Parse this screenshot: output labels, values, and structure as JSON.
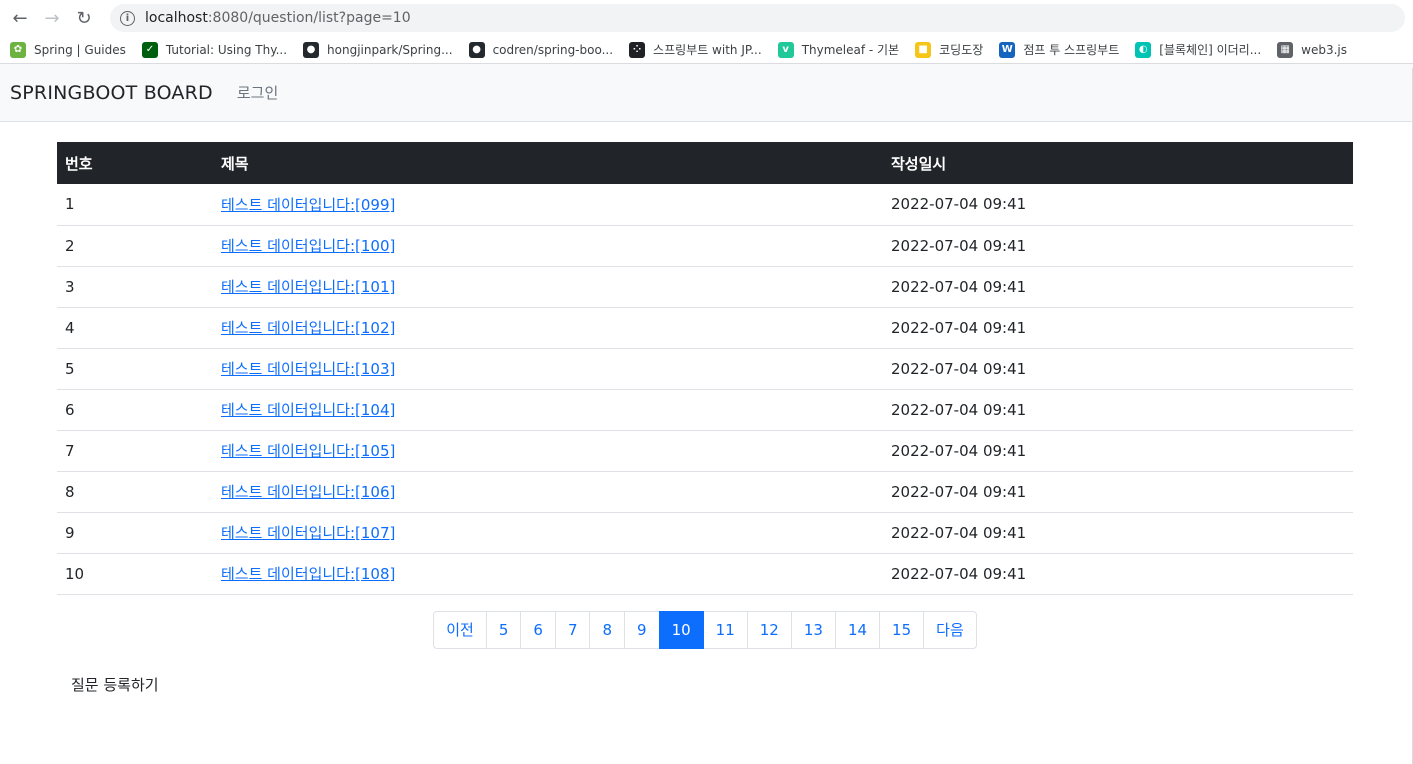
{
  "browser": {
    "url_host": "localhost",
    "url_rest": ":8080/question/list?page=10",
    "bookmarks": [
      {
        "label": "Spring | Guides",
        "icon": "spring-leaf-icon",
        "color": "#6db33f"
      },
      {
        "label": "Tutorial: Using Thy...",
        "icon": "thymeleaf-icon",
        "color": "#005f0f"
      },
      {
        "label": "hongjinpark/Spring...",
        "icon": "github-icon",
        "color": "#24292e"
      },
      {
        "label": "codren/spring-boo...",
        "icon": "github-icon",
        "color": "#24292e"
      },
      {
        "label": "스프링부트 with JP...",
        "icon": "dots-icon",
        "color": "#202124"
      },
      {
        "label": "Thymeleaf - 기본",
        "icon": "velog-icon",
        "color": "#20c997"
      },
      {
        "label": "코딩도장",
        "icon": "codingdojang-icon",
        "color": "#f5c518"
      },
      {
        "label": "점프 투 스프링부트",
        "icon": "wikidocs-icon",
        "color": "#1565c0"
      },
      {
        "label": "[블록체인] 이더리...",
        "icon": "chain-icon",
        "color": "#00c4b3"
      },
      {
        "label": "web3.js",
        "icon": "web3-icon",
        "color": "#5f6368"
      }
    ]
  },
  "navbar": {
    "brand": "SPRINGBOOT BOARD",
    "login": "로그인"
  },
  "table": {
    "headers": {
      "num": "번호",
      "title": "제목",
      "date": "작성일시"
    },
    "rows": [
      {
        "num": "1",
        "title": "테스트 데이터입니다:[099]",
        "date": "2022-07-04 09:41"
      },
      {
        "num": "2",
        "title": "테스트 데이터입니다:[100]",
        "date": "2022-07-04 09:41"
      },
      {
        "num": "3",
        "title": "테스트 데이터입니다:[101]",
        "date": "2022-07-04 09:41"
      },
      {
        "num": "4",
        "title": "테스트 데이터입니다:[102]",
        "date": "2022-07-04 09:41"
      },
      {
        "num": "5",
        "title": "테스트 데이터입니다:[103]",
        "date": "2022-07-04 09:41"
      },
      {
        "num": "6",
        "title": "테스트 데이터입니다:[104]",
        "date": "2022-07-04 09:41"
      },
      {
        "num": "7",
        "title": "테스트 데이터입니다:[105]",
        "date": "2022-07-04 09:41"
      },
      {
        "num": "8",
        "title": "테스트 데이터입니다:[106]",
        "date": "2022-07-04 09:41"
      },
      {
        "num": "9",
        "title": "테스트 데이터입니다:[107]",
        "date": "2022-07-04 09:41"
      },
      {
        "num": "10",
        "title": "테스트 데이터입니다:[108]",
        "date": "2022-07-04 09:41"
      }
    ]
  },
  "pagination": {
    "prev": "이전",
    "next": "다음",
    "pages": [
      "5",
      "6",
      "7",
      "8",
      "9",
      "10",
      "11",
      "12",
      "13",
      "14",
      "15"
    ],
    "current": "10"
  },
  "create_button": "질문 등록하기"
}
